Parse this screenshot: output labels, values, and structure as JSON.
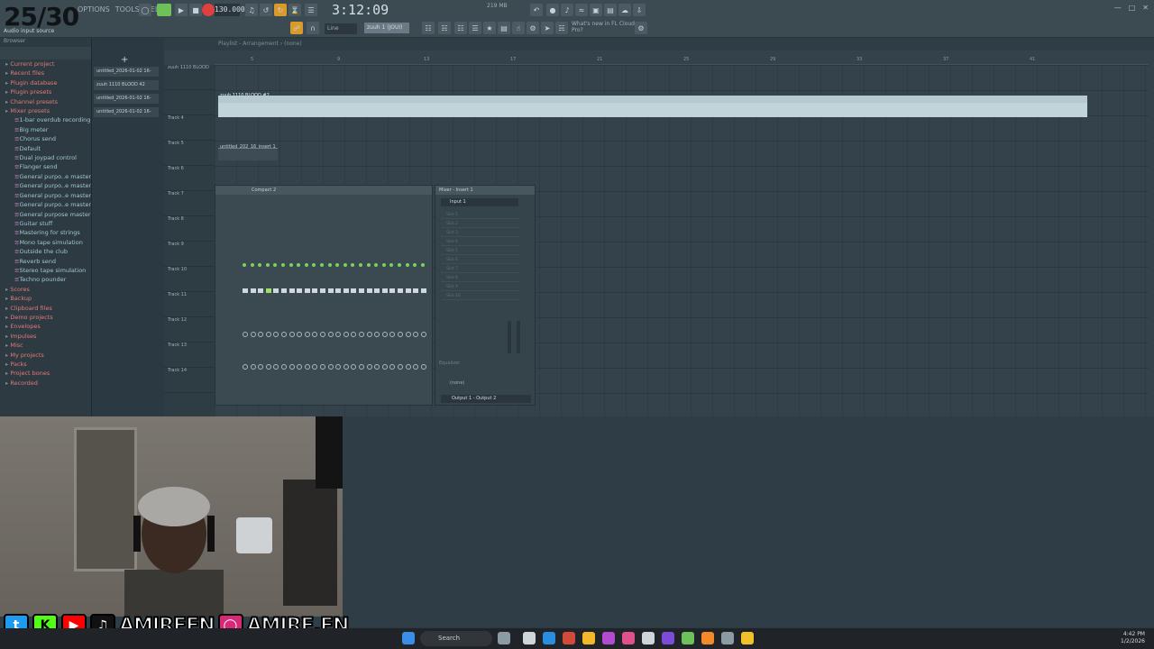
{
  "overlay": {
    "counter": "25/30"
  },
  "toolbar": {
    "menu": [
      "OPTIONS",
      "TOOLS",
      "HELP"
    ],
    "tempo": "130.000",
    "song_time": "3:12:09",
    "cpu": "219 MB",
    "tip": "Audio input source",
    "snap": "Line",
    "pattern": "zuuh 1 (JOUI)",
    "news": "What's new in FL Cloud Pro?"
  },
  "browser": {
    "header": "Browser",
    "items": [
      {
        "label": "Current project",
        "kind": "folder"
      },
      {
        "label": "Recent files",
        "kind": "folder"
      },
      {
        "label": "Plugin database",
        "kind": "folder"
      },
      {
        "label": "Plugin presets",
        "kind": "folder"
      },
      {
        "label": "Channel presets",
        "kind": "folder"
      },
      {
        "label": "Mixer presets",
        "kind": "folder"
      },
      {
        "label": "1-bar overdub recording",
        "kind": "child"
      },
      {
        "label": "Big meter",
        "kind": "child"
      },
      {
        "label": "Chorus send",
        "kind": "child"
      },
      {
        "label": "Default",
        "kind": "child"
      },
      {
        "label": "Dual joypad control",
        "kind": "child"
      },
      {
        "label": "Flanger send",
        "kind": "child"
      },
      {
        "label": "General purpo..e mastering",
        "kind": "child"
      },
      {
        "label": "General purpo..e mastering 2",
        "kind": "child"
      },
      {
        "label": "General purpo..e mastering 3",
        "kind": "child"
      },
      {
        "label": "General purpo..e mastering 4",
        "kind": "child"
      },
      {
        "label": "General purpose mastering",
        "kind": "child"
      },
      {
        "label": "Guitar stuff",
        "kind": "child"
      },
      {
        "label": "Mastering for strings",
        "kind": "child"
      },
      {
        "label": "Mono tape simulation",
        "kind": "child"
      },
      {
        "label": "Outside the club",
        "kind": "child"
      },
      {
        "label": "Reverb send",
        "kind": "child"
      },
      {
        "label": "Stereo tape simulation",
        "kind": "child"
      },
      {
        "label": "Techno pounder",
        "kind": "child"
      },
      {
        "label": "Scores",
        "kind": "folder"
      },
      {
        "label": "Backup",
        "kind": "folder"
      },
      {
        "label": "Clipboard files",
        "kind": "folder"
      },
      {
        "label": "Demo projects",
        "kind": "folder"
      },
      {
        "label": "Envelopes",
        "kind": "folder"
      },
      {
        "label": "Impulses",
        "kind": "folder"
      },
      {
        "label": "Misc",
        "kind": "folder"
      },
      {
        "label": "My projects",
        "kind": "folder"
      },
      {
        "label": "Packs",
        "kind": "folder"
      },
      {
        "label": "Project bones",
        "kind": "folder"
      },
      {
        "label": "Recorded",
        "kind": "folder"
      }
    ]
  },
  "recent_projects": [
    "untitled_2026-01-02 16-",
    "zuuh 1110 BLOOD 42",
    "untitled_2026-01-02 16-",
    "untitled_2026-01-02 16-"
  ],
  "playlist": {
    "title": "Playlist - Arrangement › (none)",
    "ruler": [
      "5",
      "9",
      "13",
      "17",
      "21",
      "25",
      "29",
      "33",
      "37",
      "41"
    ],
    "tracks": [
      "zuuh 1110 BLOOD",
      "",
      "Track 4",
      "Track 5",
      "Track 6",
      "Track 7",
      "Track 8",
      "Track 9",
      "Track 10",
      "Track 11",
      "Track 12",
      "Track 13",
      "Track 14"
    ],
    "clip1_label": "zuuh 1110 BLOOD #2",
    "clip2_label": "untitled_202_16_insert 1"
  },
  "channel_rack": {
    "title": "Compact 2"
  },
  "mixer": {
    "title": "Mixer - Insert 1",
    "input": "Input 1",
    "slots": [
      "Slot 1",
      "Slot 2",
      "Slot 3",
      "Slot 4",
      "Slot 5",
      "Slot 6",
      "Slot 7",
      "Slot 8",
      "Slot 9",
      "Slot 10"
    ],
    "eq_label": "Equalizer",
    "none_label": "(none)",
    "output": "Output 1 - Output 2"
  },
  "social": {
    "handle1": "AMIREFN",
    "handle2": "AMIRE.FN"
  },
  "taskbar": {
    "search": "Search",
    "time": "4:42 PM",
    "date": "1/2/2026"
  },
  "colors": {
    "accent": "#e04040",
    "folder": "#e07a7a",
    "clip": "#c1d4da"
  }
}
